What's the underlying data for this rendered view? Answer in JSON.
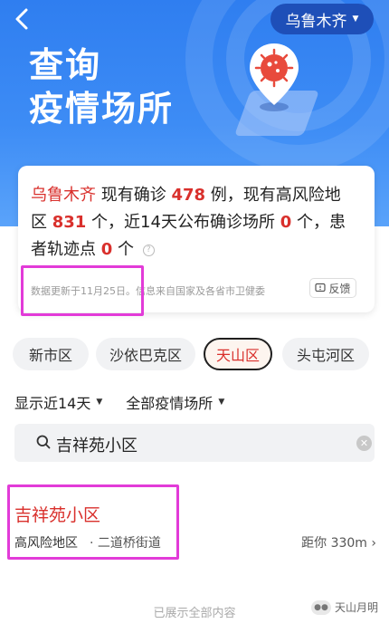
{
  "header": {
    "city": "乌鲁木齐",
    "title_line1": "查询",
    "title_line2": "疫情场所"
  },
  "summary": {
    "city": "乌鲁木齐",
    "t1": "现有确诊",
    "confirmed": "478",
    "t2": "例，现有高风险地区",
    "high_risk_areas": "831",
    "t3": "个，近14天公布确诊场所",
    "confirmed_places": "0",
    "t4": "个，患者轨迹点",
    "track_points": "0",
    "t5": "个",
    "update_note": "数据更新于11月25日。信息来自国家及各省市卫健委",
    "feedback_label": "反馈"
  },
  "tabs": [
    {
      "label": "新市区",
      "active": false
    },
    {
      "label": "沙依巴克区",
      "active": false
    },
    {
      "label": "天山区",
      "active": true
    },
    {
      "label": "头屯河区",
      "active": false
    }
  ],
  "filters": {
    "time": "显示近14天",
    "type": "全部疫情场所"
  },
  "search": {
    "value": "吉祥苑小区"
  },
  "result": {
    "name": "吉祥苑小区",
    "risk": "高风险地区",
    "street": "· 二道桥街道",
    "distance": "距你 330m"
  },
  "footer": {
    "end_note": "已展示全部内容",
    "watermark": "天山月明"
  },
  "colors": {
    "brand_blue": "#2f7ef0",
    "alert_red": "#d9302c",
    "annotation_magenta": "#e23bd8"
  }
}
